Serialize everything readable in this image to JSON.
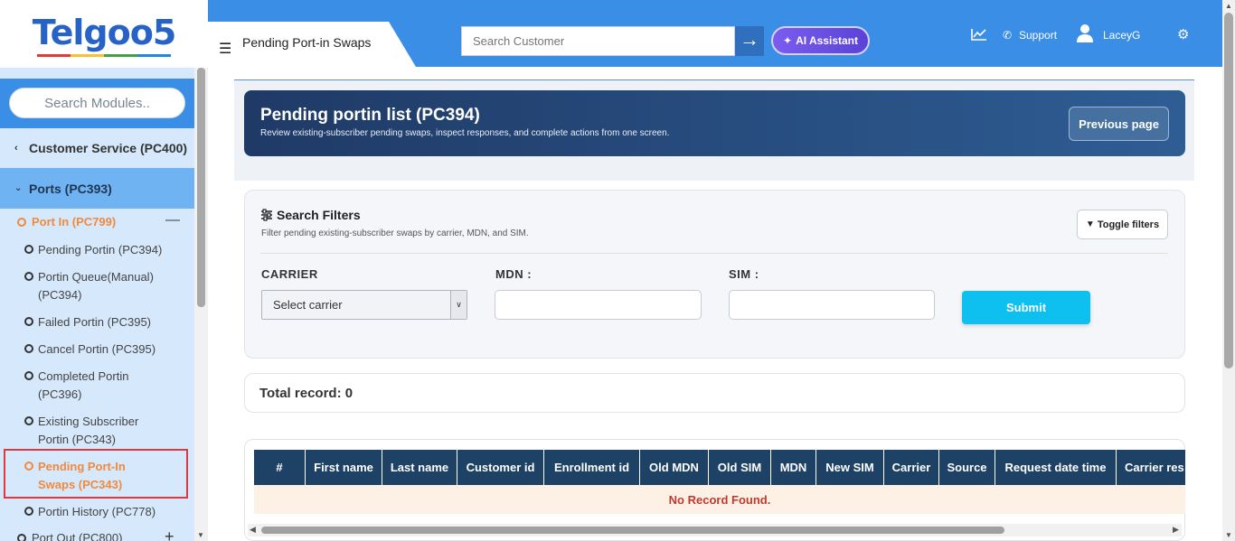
{
  "logo": {
    "text": "Telgoo5",
    "underline_colors": [
      "#e53935",
      "#fbc02d",
      "#43a047",
      "#1e88e5"
    ]
  },
  "sidebar": {
    "search_placeholder": "Search Modules..",
    "customer_service": "Customer Service (PC400)",
    "ports": "Ports (PC393)",
    "port_in": "Port In (PC799)",
    "port_in_toggle": "—",
    "items": [
      {
        "label": "Pending Portin (PC394)"
      },
      {
        "label": "Portin Queue(Manual) (PC394)"
      },
      {
        "label": "Failed Portin (PC395)"
      },
      {
        "label": "Cancel Portin (PC395)"
      },
      {
        "label": "Completed Portin (PC396)"
      },
      {
        "label": "Existing Subscriber Portin (PC343)"
      },
      {
        "label": "Pending Port-In Swaps (PC343)"
      },
      {
        "label": "Portin History (PC778)"
      }
    ],
    "port_out": "Port Out (PC800)",
    "port_out_toggle": "+"
  },
  "header": {
    "page_title": "Pending Port-in Swaps",
    "search_placeholder": "Search Customer",
    "ai_button": "AI Assistant",
    "support": "Support",
    "username": "LaceyG"
  },
  "hero": {
    "title": "Pending portin list (PC394)",
    "subtitle": "Review existing-subscriber pending swaps, inspect responses, and complete actions from one screen.",
    "previous_button": "Previous page"
  },
  "filters": {
    "title": "Search Filters",
    "subtitle": "Filter pending existing-subscriber swaps by carrier, MDN, and SIM.",
    "toggle_button": "Toggle filters",
    "carrier_label": "CARRIER",
    "carrier_value": "Select carrier",
    "mdn_label": "MDN :",
    "sim_label": "SIM :",
    "submit": "Submit"
  },
  "total": {
    "text": "Total record: 0"
  },
  "table": {
    "headers": [
      "#",
      "First name",
      "Last name",
      "Customer id",
      "Enrollment id",
      "Old MDN",
      "Old SIM",
      "MDN",
      "New SIM",
      "Carrier",
      "Source",
      "Request date time",
      "Carrier res"
    ],
    "empty_message": "No Record Found."
  },
  "colors": {
    "brand_blue": "#3a8ee6",
    "hero_dark": "#1f3a66",
    "active_orange": "#f08a3e",
    "submit_cyan": "#0dc0f0",
    "table_head": "#1e4266"
  }
}
